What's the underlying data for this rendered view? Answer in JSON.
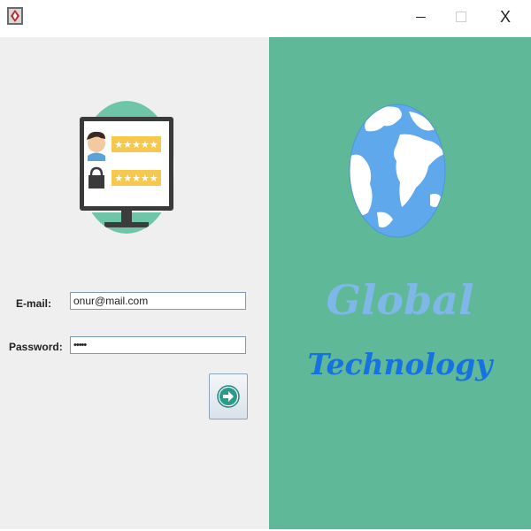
{
  "window": {
    "minimize_glyph": "",
    "close_glyph": "X"
  },
  "icons": {
    "app": "java-app-icon",
    "login_illustration": "login-screen-illustration",
    "globe": "globe-icon",
    "submit": "arrow-right-circle-icon"
  },
  "colors": {
    "left_panel": "#efefef",
    "right_panel": "#5fb998",
    "brand_line_1": "#7fb7e8",
    "brand_line_2": "#1672e0"
  },
  "login": {
    "email_label": "E-mail:",
    "email_value": "onur@mail.com",
    "password_label": "Password:",
    "password_value": "•••••"
  },
  "brand": {
    "line1": "Global",
    "line2": "Technology"
  }
}
